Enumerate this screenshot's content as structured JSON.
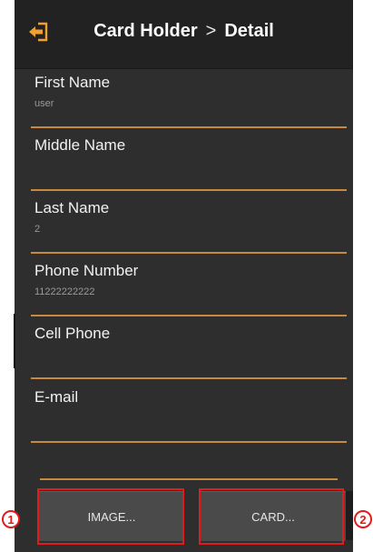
{
  "header": {
    "back_icon": "back-arrow-icon",
    "title": "Card Holder",
    "separator": ">",
    "subtitle": "Detail"
  },
  "fields": [
    {
      "label": "First Name",
      "value": "user"
    },
    {
      "label": "Middle Name",
      "value": ""
    },
    {
      "label": "Last Name",
      "value": "2"
    },
    {
      "label": "Phone Number",
      "value": "11222222222"
    },
    {
      "label": "Cell Phone",
      "value": ""
    },
    {
      "label": "E-mail",
      "value": ""
    }
  ],
  "buttons": {
    "image_label": "IMAGE...",
    "card_label": "CARD..."
  },
  "annotations": {
    "one": "1",
    "two": "2"
  },
  "colors": {
    "background": "#2e2e2e",
    "header": "#222222",
    "accent_line": "#c78a3c",
    "annotation": "#e31b1b",
    "icon": "#f0a030"
  }
}
